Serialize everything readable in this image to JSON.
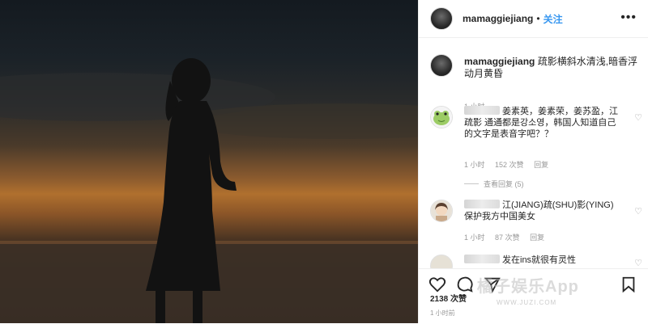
{
  "post": {
    "username": "mamaggiejiang",
    "follow_label": "关注",
    "dot": "•",
    "more_icon": "more-horizontal-icon"
  },
  "caption": {
    "username": "mamaggiejiang",
    "text": "疏影横斜水清浅,暗香浮动月黄昏",
    "time": "1 小时"
  },
  "comments": [
    {
      "text": "姜素英，姜素荣，姜苏盈，江疏影 通通都是강소영，韩国人知道自己的文字是表音字吧？？",
      "time": "1 小时",
      "likes": "152 次赞",
      "reply": "回复",
      "view_replies": "查看回复 (5)"
    },
    {
      "text": "江(JIANG)疏(SHU)影(YING) 保护我方中国美女",
      "time": "1 小时",
      "likes": "87 次赞",
      "reply": "回复"
    },
    {
      "text": "发在ins就很有灵性"
    }
  ],
  "footer": {
    "likes": "2138 次赞",
    "time_ago": "1 小时前"
  },
  "watermark": {
    "text": "橘子娱乐App",
    "sub": "WWW.JUZI.COM"
  },
  "icons": [
    "heart-icon",
    "comment-icon",
    "share-icon",
    "bookmark-icon",
    "heart-small-icon",
    "frog-avatar",
    "girl-avatar"
  ],
  "colors": {
    "link": "#3897f0",
    "meta": "#999999",
    "text": "#262626"
  }
}
